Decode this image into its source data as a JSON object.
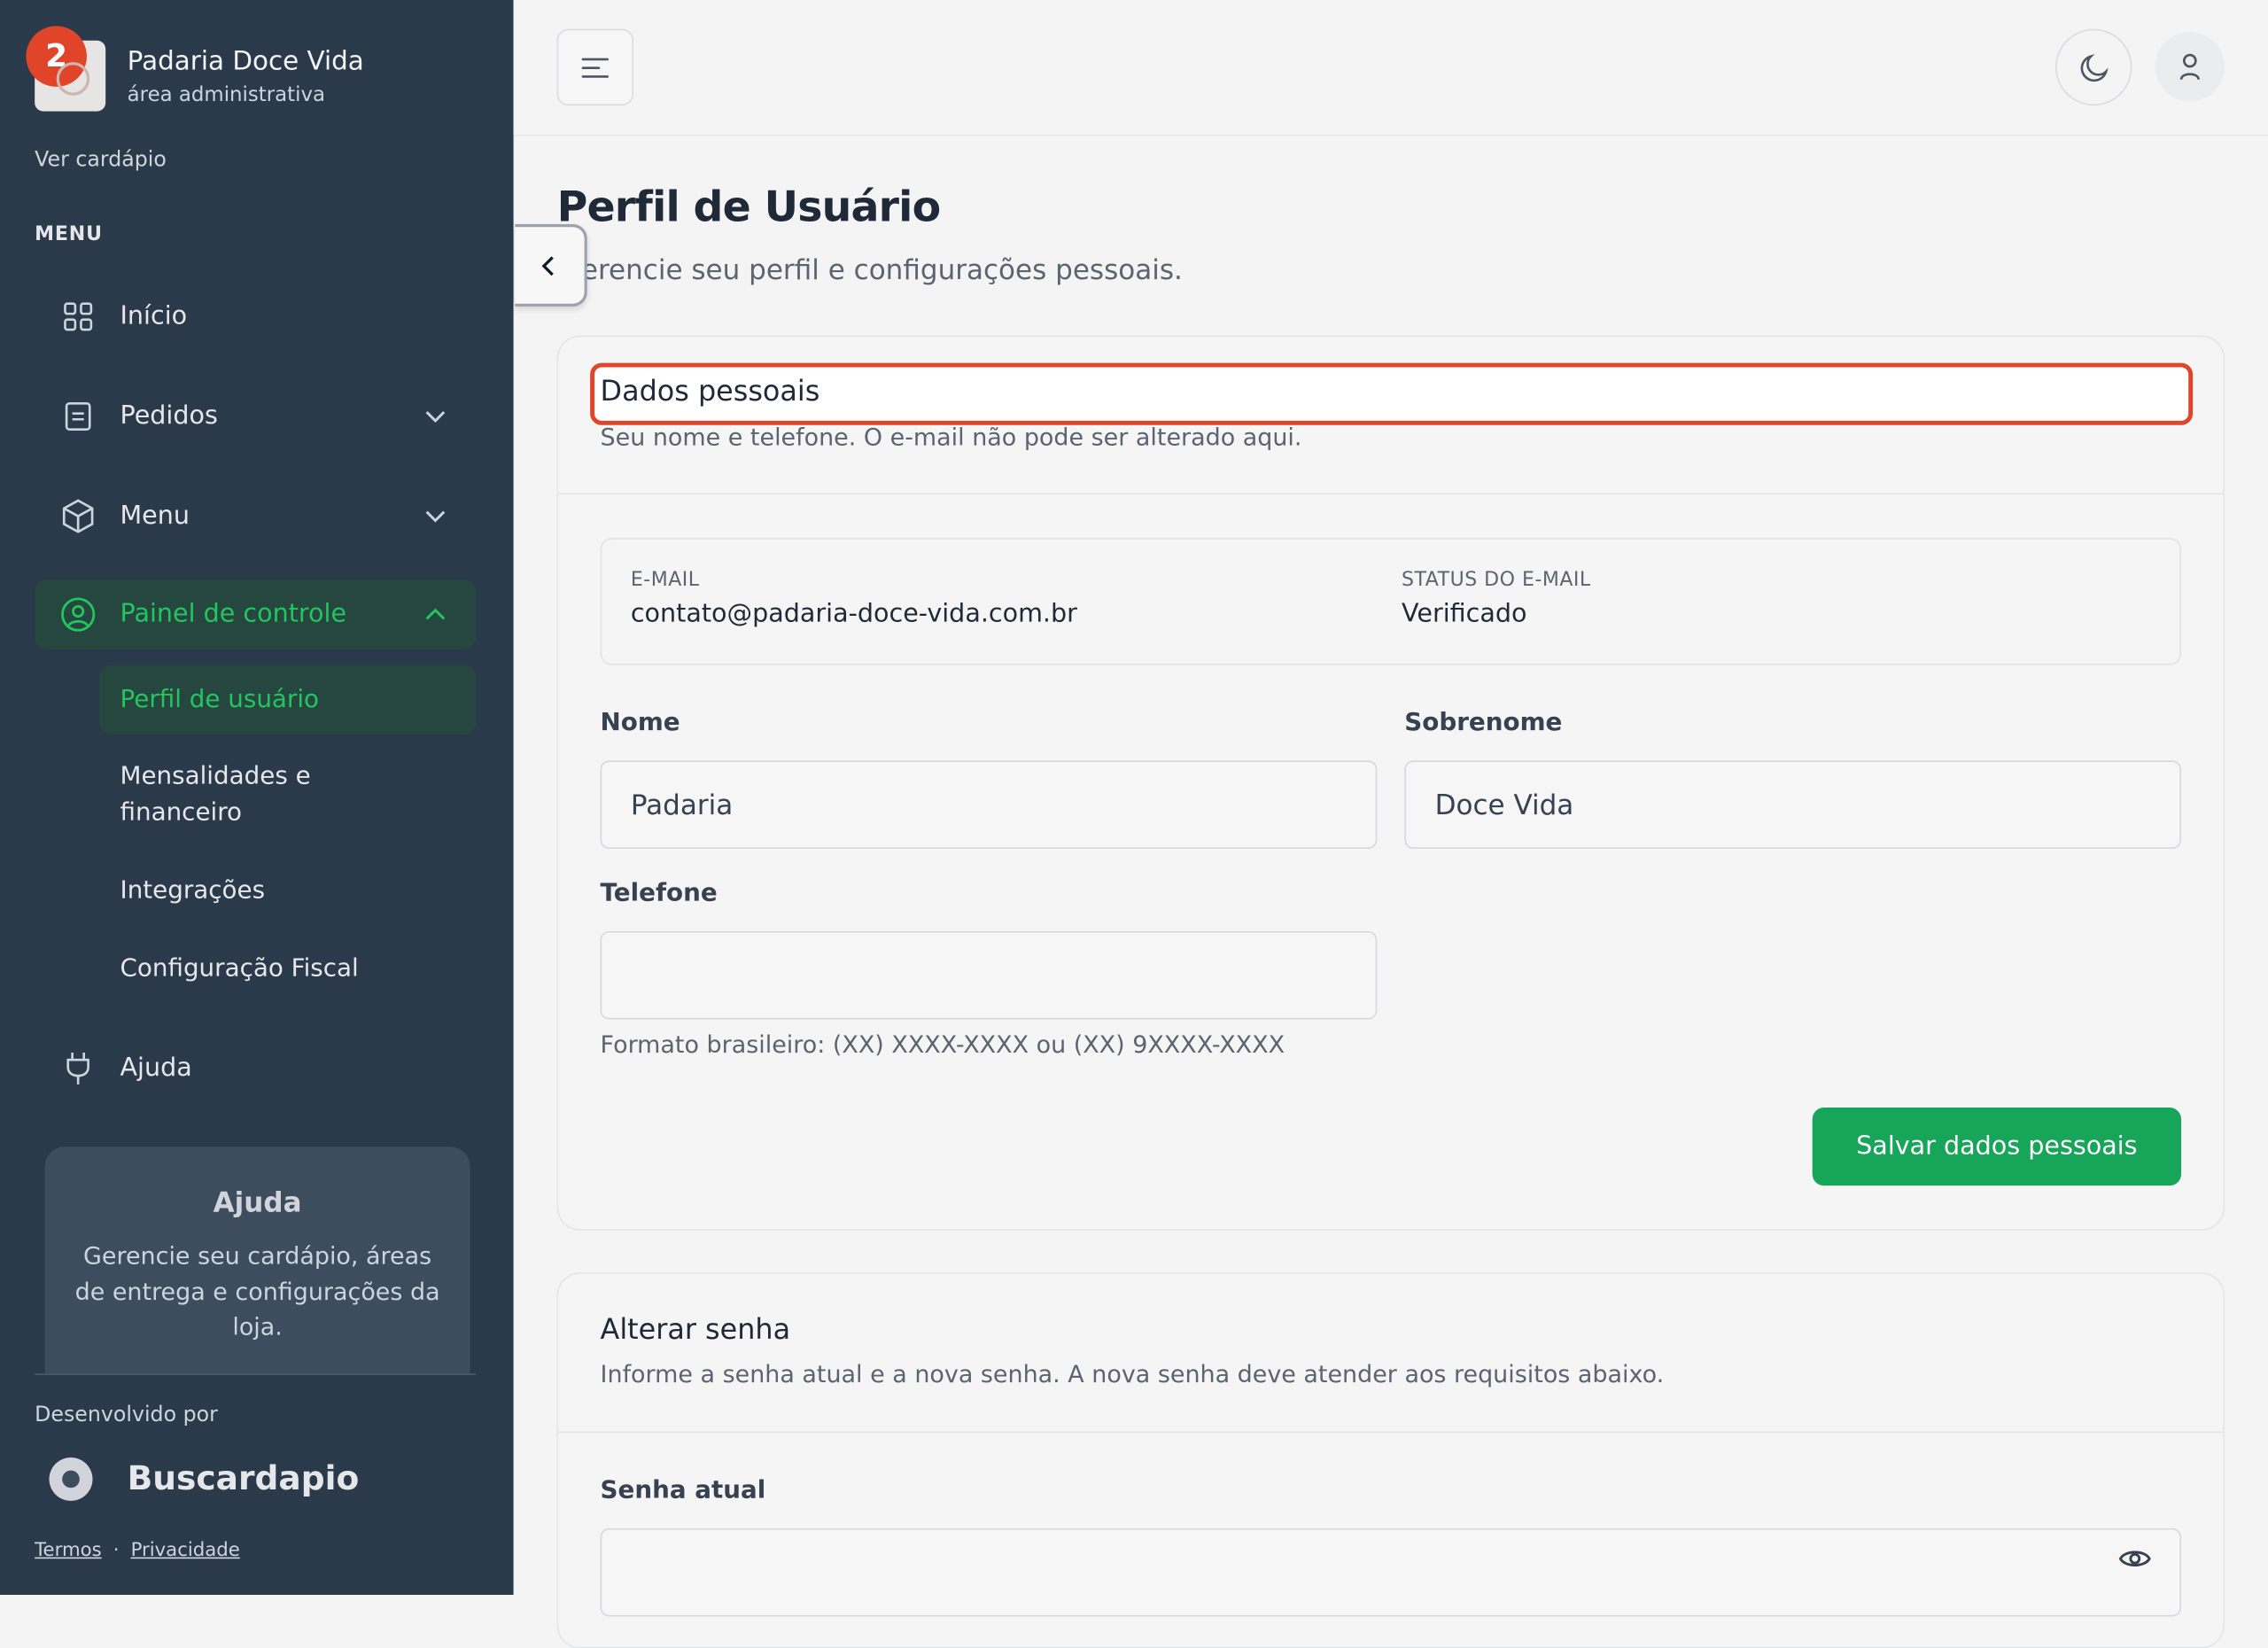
{
  "brand": {
    "badge": "2",
    "name": "Padaria Doce Vida",
    "subtitle": "área administrativa"
  },
  "sidebar": {
    "view_menu_link": "Ver cardápio",
    "menu_heading": "MENU",
    "items": [
      {
        "label": "Início",
        "icon": "grid-icon"
      },
      {
        "label": "Pedidos",
        "icon": "document-icon"
      },
      {
        "label": "Menu",
        "icon": "box-icon"
      },
      {
        "label": "Painel de controle",
        "icon": "user-circle-icon"
      }
    ],
    "subitems": [
      {
        "label": "Perfil de usuário"
      },
      {
        "label": "Mensalidades e financeiro"
      },
      {
        "label": "Integrações"
      },
      {
        "label": "Configuração Fiscal"
      }
    ],
    "help_item": {
      "label": "Ajuda",
      "icon": "plug-icon"
    },
    "help_card": {
      "title": "Ajuda",
      "text": "Gerencie seu cardápio, áreas de entrega e configurações da loja."
    },
    "developed_by": "Desenvolvido por",
    "dev_name": "Buscardapio",
    "terms": "Termos",
    "separator": "·",
    "privacy": "Privacidade"
  },
  "page": {
    "title": "Perfil de Usuário",
    "subtitle": "Gerencie seu perfil e configurações pessoais."
  },
  "personal": {
    "title": "Dados pessoais",
    "description": "Seu nome e telefone. O e-mail não pode ser alterado aqui.",
    "email_label": "E-MAIL",
    "email_value": "contato@padaria-doce-vida.com.br",
    "status_label": "STATUS DO E-MAIL",
    "status_value": "Verificado",
    "first_name_label": "Nome",
    "first_name_value": "Padaria",
    "last_name_label": "Sobrenome",
    "last_name_value": "Doce Vida",
    "phone_label": "Telefone",
    "phone_value": "",
    "phone_hint": "Formato brasileiro: (XX) XXXX-XXXX ou (XX) 9XXXX-XXXX",
    "save_label": "Salvar dados pessoais"
  },
  "password": {
    "title": "Alterar senha",
    "description": "Informe a senha atual e a nova senha. A nova senha deve atender aos requisitos abaixo.",
    "current_label": "Senha atual",
    "current_value": ""
  },
  "colors": {
    "sidebar": "#2b3a4a",
    "accent": "#22c55e",
    "primary_button": "#17a559",
    "highlight": "#e0452a"
  }
}
